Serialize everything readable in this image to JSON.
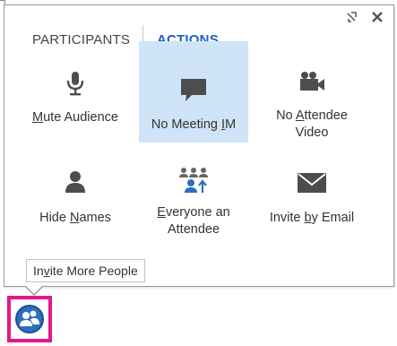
{
  "tabs": {
    "participants": "PARTICIPANTS",
    "actions": "ACTIONS"
  },
  "actions": [
    {
      "before": "",
      "underline": "M",
      "after": "ute Audience",
      "second_line": "",
      "icon": "microphone-icon",
      "selected": false
    },
    {
      "before": "No Meeting ",
      "underline": "I",
      "after": "M",
      "second_line": "",
      "icon": "speech-bubble-icon",
      "selected": true
    },
    {
      "before": "No ",
      "underline": "A",
      "after": "ttendee",
      "second_line": "Video",
      "icon": "video-camera-icon",
      "selected": false
    },
    {
      "before": "Hide ",
      "underline": "N",
      "after": "ames",
      "second_line": "",
      "icon": "person-icon",
      "selected": false
    },
    {
      "before": "",
      "underline": "E",
      "after": "veryone an",
      "second_line": "Attendee",
      "icon": "group-upgrade-icon",
      "selected": false
    },
    {
      "before": "Invite ",
      "underline": "b",
      "after": "y Email",
      "second_line": "",
      "icon": "envelope-icon",
      "selected": false
    }
  ],
  "invite_button": {
    "before": "In",
    "underline": "v",
    "after": "ite More People"
  },
  "icons": {
    "popout": "popout-icon",
    "close": "close-icon",
    "participants_button": "people-icon"
  },
  "colors": {
    "accent": "#1e5fbf",
    "selected_bg": "#cfe4f7",
    "icon_gray": "#4d4d4d",
    "highlight_border": "#e0198a",
    "participants_blue": "#2b6fc0"
  }
}
